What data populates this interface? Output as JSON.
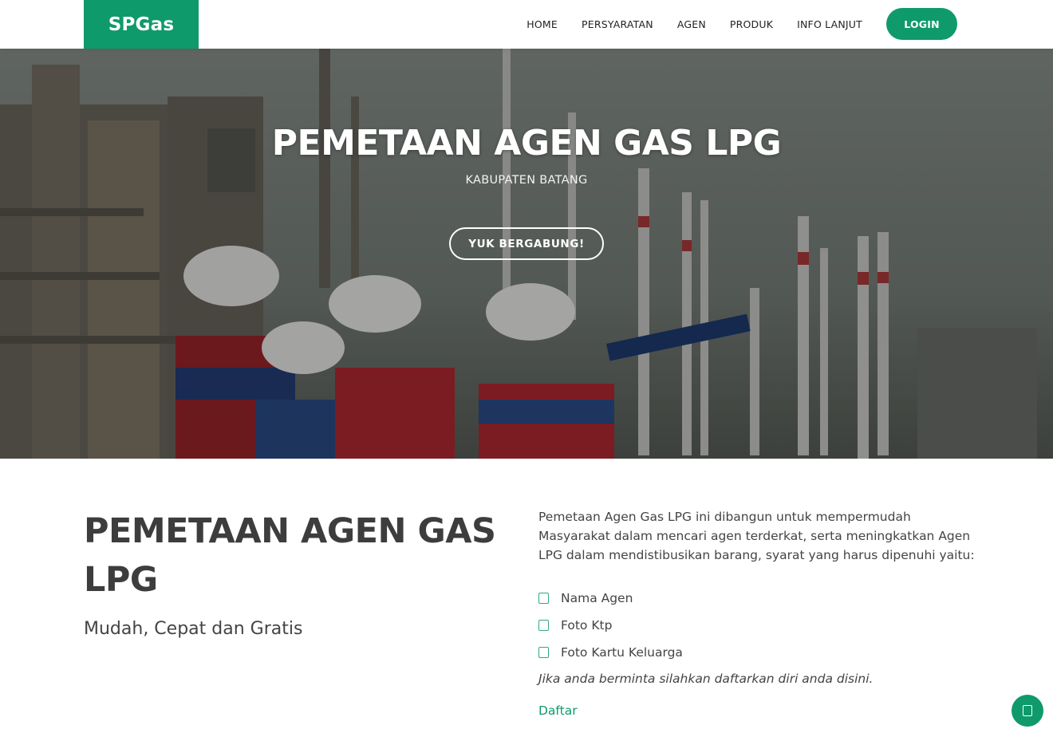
{
  "header": {
    "logo": "SPGas",
    "nav": [
      "HOME",
      "PERSYARATAN",
      "AGEN",
      "PRODUK",
      "INFO LANJUT"
    ],
    "login_label": "LOGIN"
  },
  "hero": {
    "title": "PEMETAAN AGEN GAS LPG",
    "subtitle": "KABUPATEN BATANG",
    "cta_label": "YUK BERGABUNG!"
  },
  "about": {
    "title": "PEMETAAN AGEN GAS LPG",
    "tagline": "Mudah, Cepat dan Gratis",
    "description": "Pemetaan Agen Gas LPG ini dibangun untuk mempermudah Masyarakat dalam mencari agen terderkat, serta meningkatkan Agen LPG dalam mendistibusikan barang, syarat yang harus dipenuhi yaitu:",
    "requirements": [
      "Nama Agen",
      "Foto Ktp",
      "Foto Kartu Keluarga"
    ],
    "note": "Jika anda berminta silahkan daftarkan diri anda disini.",
    "link_label": "Daftar"
  },
  "colors": {
    "accent": "#0f9a6b",
    "text": "#444444"
  },
  "icons": {
    "list_check": "check-icon",
    "back_to_top": "arrow-up-icon"
  }
}
